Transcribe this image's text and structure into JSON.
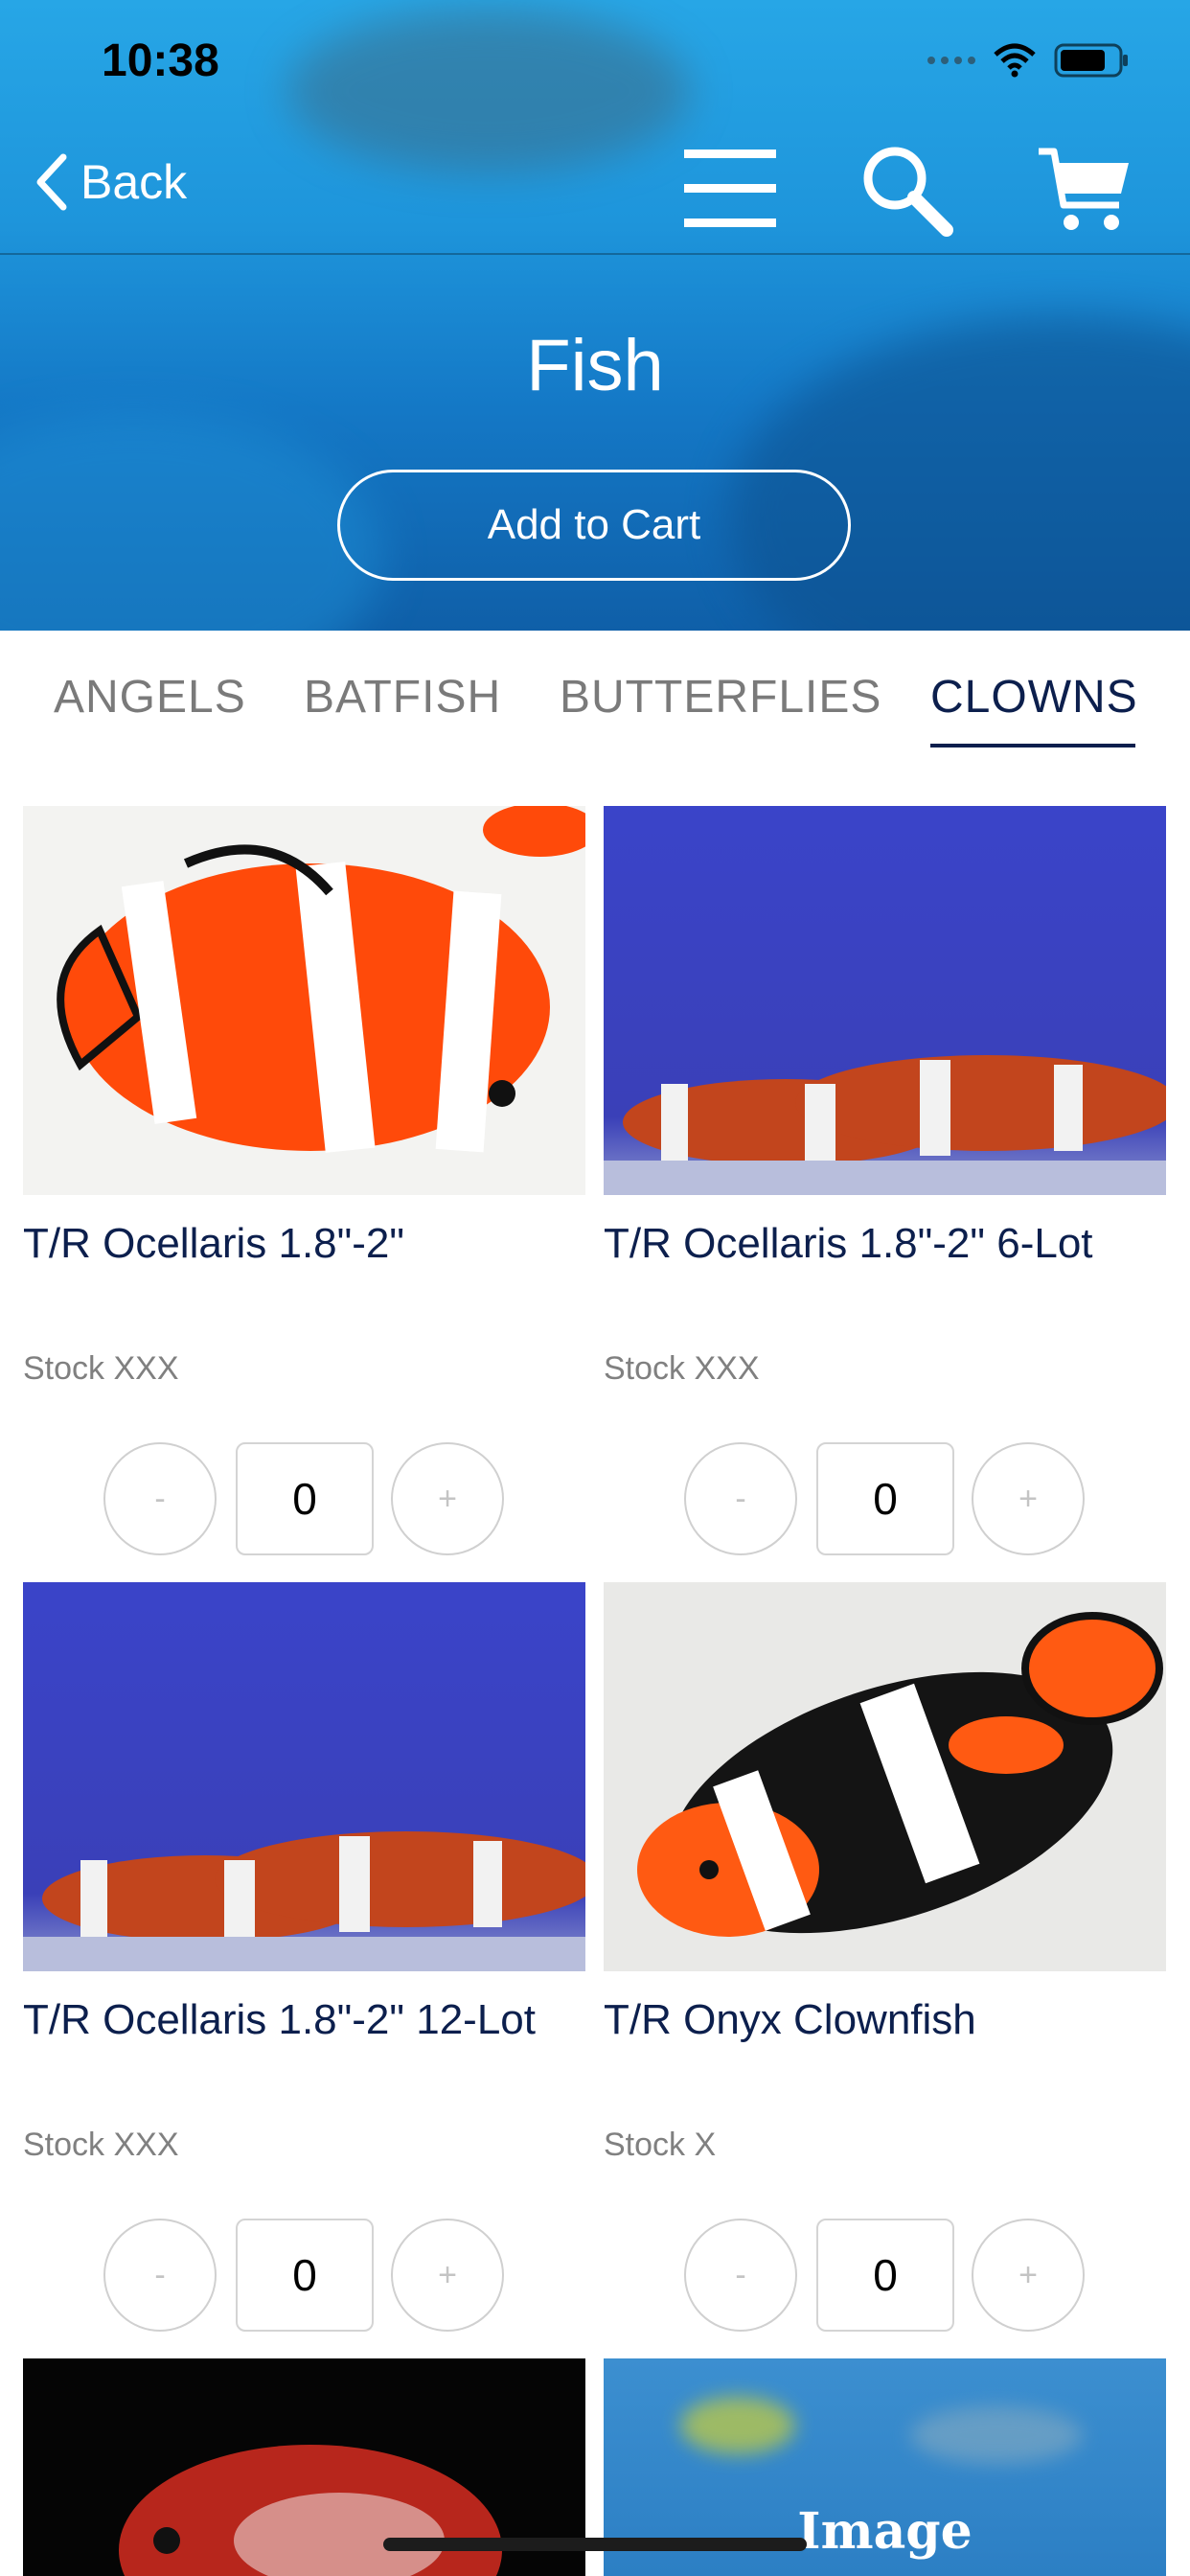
{
  "status_bar": {
    "time": "10:38"
  },
  "nav": {
    "back_label": "Back"
  },
  "header": {
    "title": "Fish",
    "add_to_cart_label": "Add to Cart"
  },
  "tabs": [
    {
      "label": "ANGELS",
      "active": false
    },
    {
      "label": "BATFISH",
      "active": false
    },
    {
      "label": "BUTTERFLIES",
      "active": false
    },
    {
      "label": "CLOWNS",
      "active": true
    }
  ],
  "products": [
    {
      "name": "T/R Ocellaris 1.8\"-2\"",
      "stock": "Stock XXX",
      "quantity": "0",
      "minus": "-",
      "plus": "+"
    },
    {
      "name": "T/R Ocellaris 1.8\"-2\" 6-Lot",
      "stock": "Stock XXX",
      "quantity": "0",
      "minus": "-",
      "plus": "+"
    },
    {
      "name": "T/R Ocellaris 1.8\"-2\" 12-Lot",
      "stock": "Stock XXX",
      "quantity": "0",
      "minus": "-",
      "plus": "+"
    },
    {
      "name": "T/R Onyx Clownfish",
      "stock": "Stock X",
      "quantity": "0",
      "minus": "-",
      "plus": "+"
    }
  ],
  "partial_row": {
    "placeholder_label": "Image"
  },
  "colors": {
    "accent": "#0c1f4d",
    "hero_blue": "#1e95db",
    "white": "#ffffff"
  },
  "icons": [
    "chevron-left-icon",
    "menu-icon",
    "search-icon",
    "cart-icon",
    "wifi-icon",
    "battery-icon"
  ]
}
